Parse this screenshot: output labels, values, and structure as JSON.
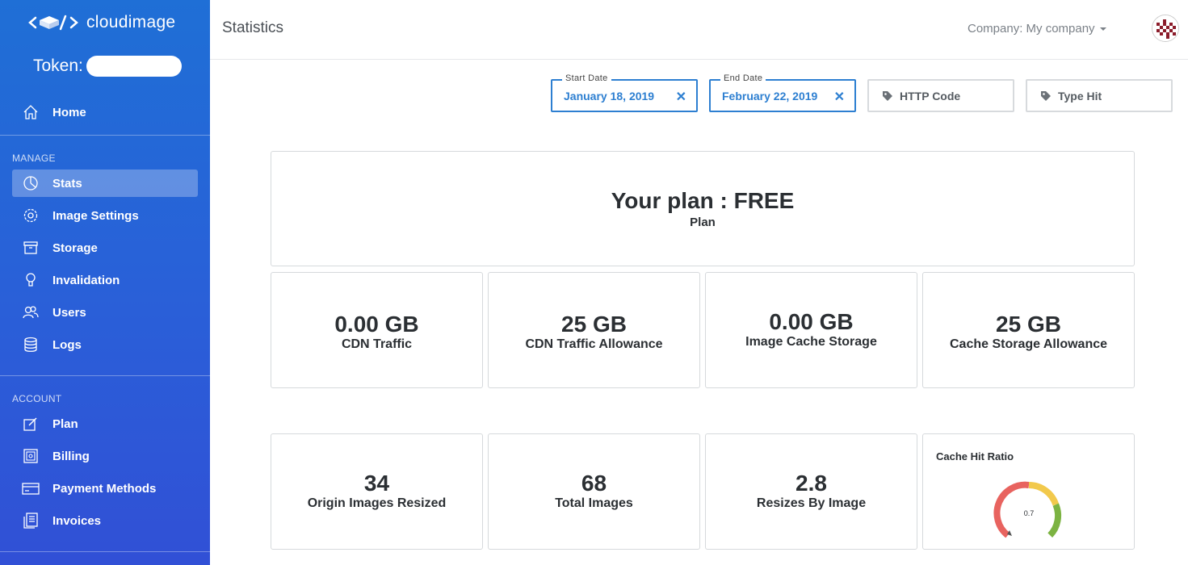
{
  "sidebar": {
    "logo_text": "cloudimage",
    "token_label": "Token:",
    "home": {
      "label": "Home",
      "icon": "home-icon"
    },
    "manage_section": "MANAGE",
    "manage_items": [
      {
        "label": "Stats",
        "icon": "stats-icon",
        "active": true
      },
      {
        "label": "Image Settings",
        "icon": "gear-icon"
      },
      {
        "label": "Storage",
        "icon": "archive-icon"
      },
      {
        "label": "Invalidation",
        "icon": "bulb-icon"
      },
      {
        "label": "Users",
        "icon": "users-icon"
      },
      {
        "label": "Logs",
        "icon": "database-icon"
      }
    ],
    "account_section": "ACCOUNT",
    "account_items": [
      {
        "label": "Plan",
        "icon": "edit-icon"
      },
      {
        "label": "Billing",
        "icon": "safe-icon"
      },
      {
        "label": "Payment Methods",
        "icon": "credit-card-icon"
      },
      {
        "label": "Invoices",
        "icon": "invoice-icon"
      }
    ]
  },
  "header": {
    "title": "Statistics",
    "company": "Company: My company"
  },
  "filters": {
    "start_date": {
      "label": "Start Date",
      "value": "January 18, 2019"
    },
    "end_date": {
      "label": "End Date",
      "value": "February 22, 2019"
    },
    "http_code": {
      "placeholder": "HTTP Code"
    },
    "type_hit": {
      "placeholder": "Type Hit"
    }
  },
  "plan": {
    "title": "Your plan : FREE",
    "subtitle": "Plan"
  },
  "stats_row1": [
    {
      "value": "0.00 GB",
      "label": "CDN Traffic"
    },
    {
      "value": "25 GB",
      "label": "CDN Traffic Allowance"
    },
    {
      "value": "0.00 GB",
      "label": "Image Cache Storage"
    },
    {
      "value": "25 GB",
      "label": "Cache Storage Allowance"
    }
  ],
  "stats_row2": [
    {
      "value": "34",
      "label": "Origin Images Resized"
    },
    {
      "value": "68",
      "label": "Total Images"
    },
    {
      "value": "2.8",
      "label": "Resizes By Image"
    }
  ],
  "gauge": {
    "title": "Cache Hit Ratio",
    "value_label": "0.7",
    "value": 0.7,
    "colors": {
      "low": "#e8635f",
      "mid": "#f2c94c",
      "high": "#7cb342"
    }
  },
  "colors": {
    "accent": "#2d7fd1",
    "sidebar": "#2a5fd8"
  }
}
